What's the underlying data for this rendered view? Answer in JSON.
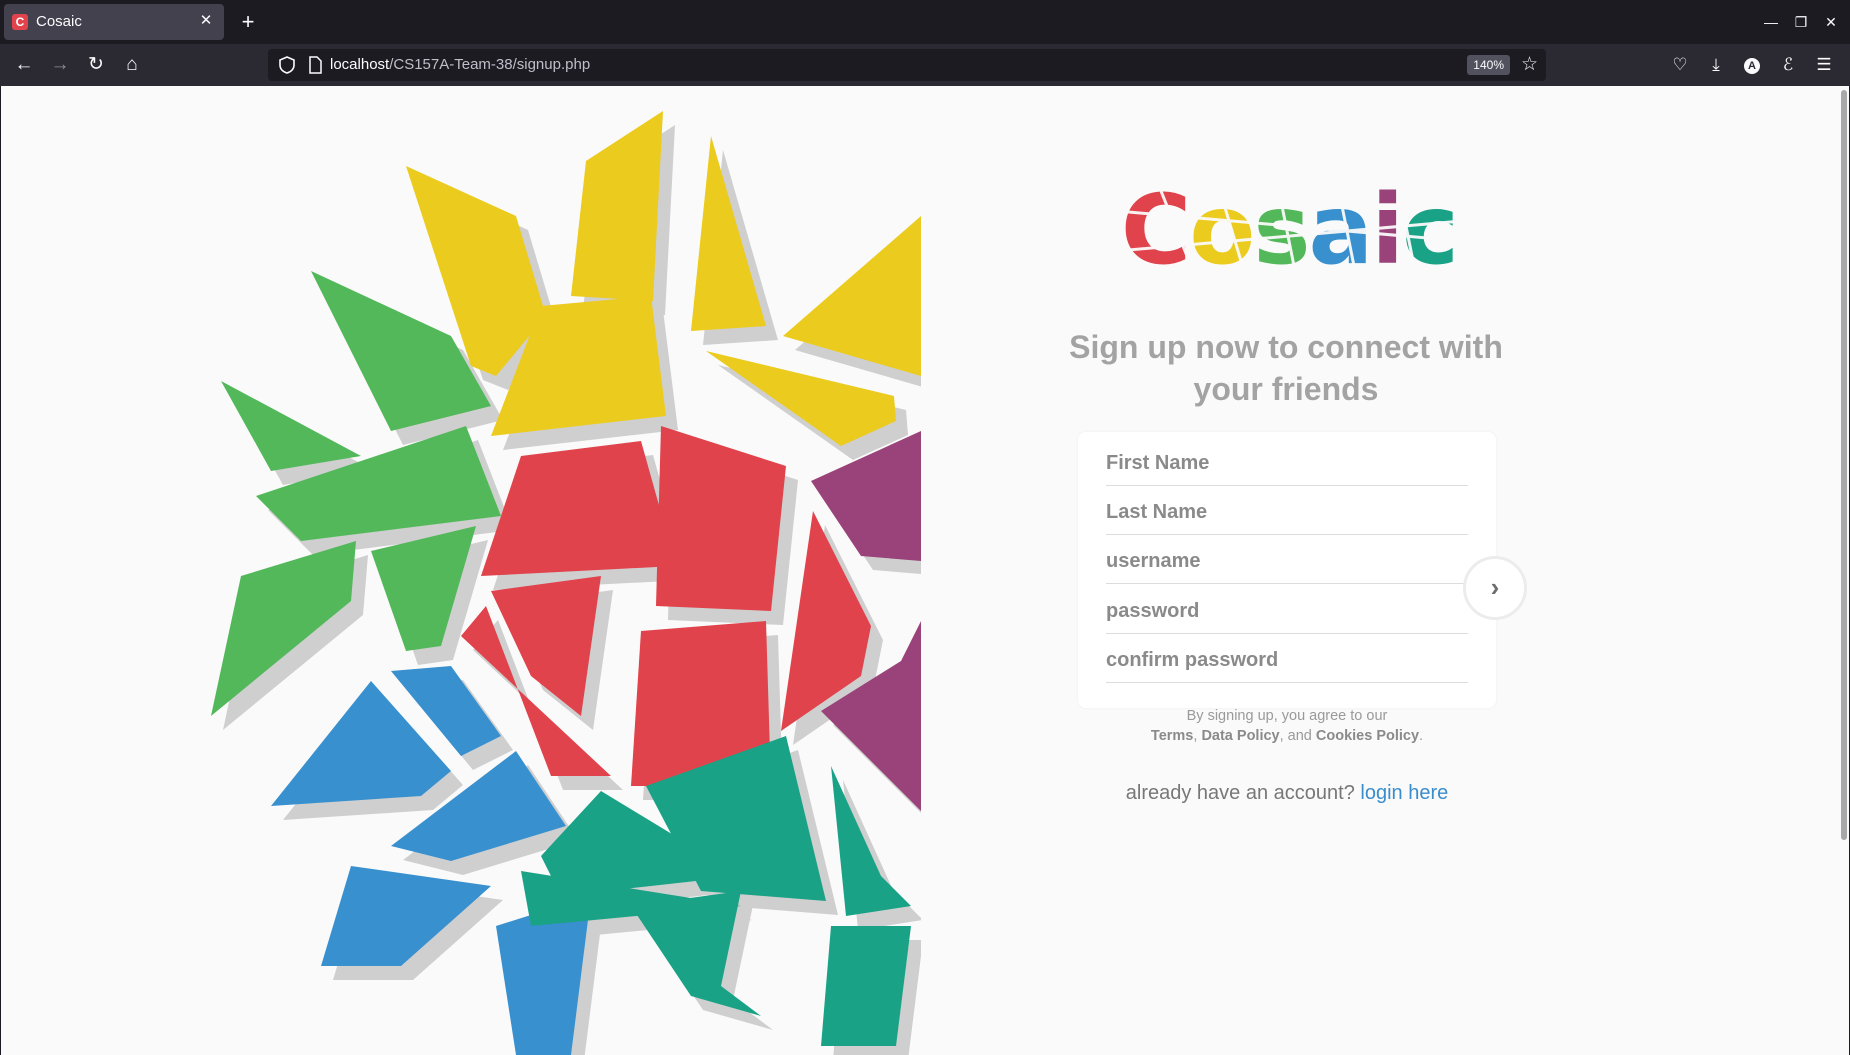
{
  "browser": {
    "tab_title": "Cosaic",
    "tab_favicon_letter": "C",
    "url_host": "localhost",
    "url_path": "/CS157A-Team-38/signup.php",
    "zoom": "140%"
  },
  "page": {
    "logo": {
      "letters": [
        "C",
        "o",
        "s",
        "a",
        "i",
        "c"
      ],
      "colors": [
        "#e0434b",
        "#ebcb1d",
        "#52b85a",
        "#3890cf",
        "#9a437a",
        "#1aa286"
      ]
    },
    "tagline": "Sign up now to connect with your friends",
    "form": {
      "first_name_placeholder": "First Name",
      "last_name_placeholder": "Last Name",
      "username_placeholder": "username",
      "password_placeholder": "password",
      "confirm_password_placeholder": "confirm password"
    },
    "terms": {
      "prefix": "By signing up, you agree to our",
      "terms": "Terms",
      "sep1": ", ",
      "data_policy": "Data Policy",
      "sep2": ", and ",
      "cookies_policy": "Cookies Policy",
      "suffix": "."
    },
    "login": {
      "prompt": "already have an account?",
      "link": "login here"
    }
  },
  "colors": {
    "red": "#e0434b",
    "yellow": "#ebcb1d",
    "green": "#52b85a",
    "blue": "#3890cf",
    "purple": "#9a437a",
    "teal": "#1aa286",
    "link": "#3a8dcc"
  },
  "icons": [
    "back-icon",
    "forward-icon",
    "reload-icon",
    "home-icon",
    "shield-icon",
    "page-icon",
    "star-icon",
    "pocket-icon",
    "download-icon",
    "account-icon",
    "extension-icon",
    "menu-icon",
    "chevron-right-icon"
  ]
}
